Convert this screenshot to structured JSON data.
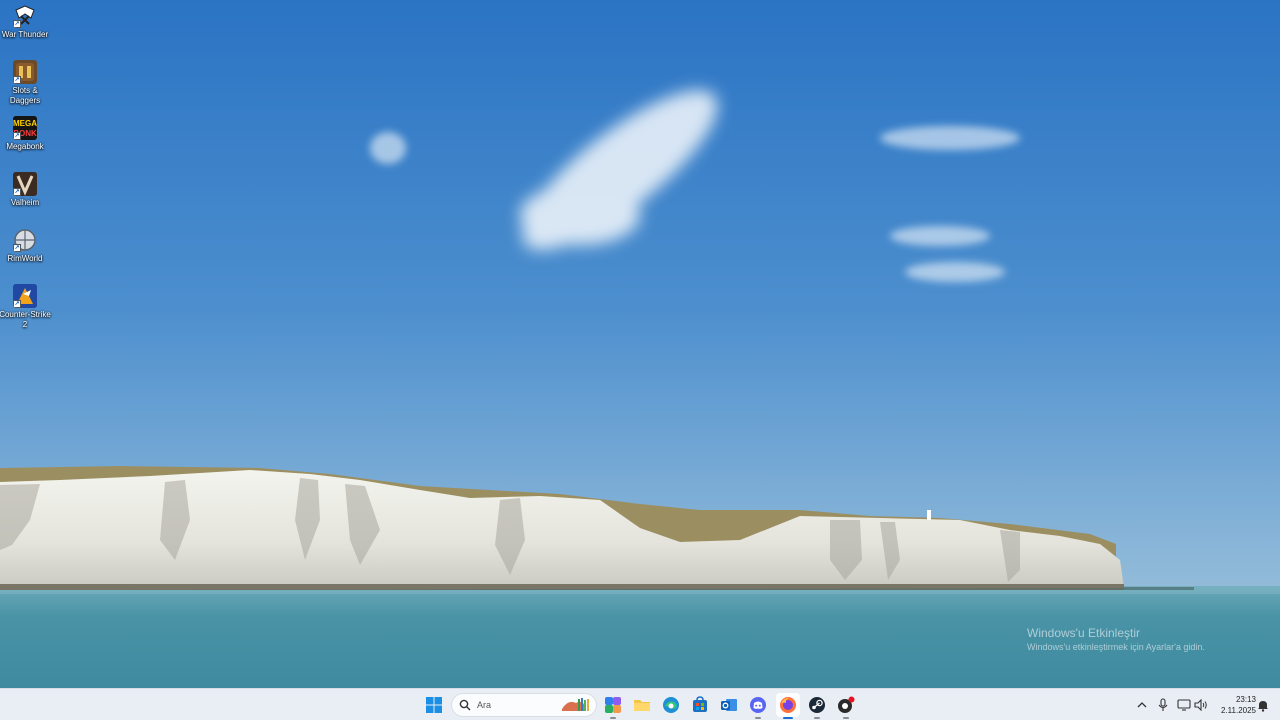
{
  "desktop": {
    "icons": [
      {
        "label": "War Thunder",
        "icon": "war-thunder-icon"
      },
      {
        "label": "Slots & Daggers",
        "icon": "slots-daggers-icon"
      },
      {
        "label": "Megabonk",
        "icon": "megabonk-icon",
        "glyph": "MEGA\nBONK"
      },
      {
        "label": "Valheim",
        "icon": "valheim-icon",
        "glyph": "V"
      },
      {
        "label": "RimWorld",
        "icon": "rimworld-icon"
      },
      {
        "label": "Counter-Strike 2",
        "icon": "counter-strike-2-icon"
      }
    ]
  },
  "activation": {
    "title": "Windows'u Etkinleştir",
    "subtitle": "Windows'u etkinleştirmek için Ayarlar'a gidin."
  },
  "taskbar": {
    "search_placeholder": "Ara",
    "apps": [
      {
        "name": "start-button",
        "icon": "windows-logo-icon"
      },
      {
        "name": "copilot",
        "icon": "copilot-icon"
      },
      {
        "name": "file-explorer",
        "icon": "folder-icon"
      },
      {
        "name": "edge",
        "icon": "edge-icon"
      },
      {
        "name": "microsoft-store",
        "icon": "store-icon"
      },
      {
        "name": "outlook",
        "icon": "outlook-icon"
      },
      {
        "name": "discord",
        "icon": "discord-icon"
      },
      {
        "name": "firefox",
        "icon": "firefox-icon"
      },
      {
        "name": "steam",
        "icon": "steam-icon"
      },
      {
        "name": "app-with-badge",
        "icon": "notification-app-icon"
      }
    ],
    "tray": {
      "time": "23:13",
      "date": "2.11.2025"
    }
  },
  "colors": {
    "sky_top": "#2f78c6",
    "sky_bottom": "#a9c9de",
    "sea": "#4f96a8",
    "taskbar": "#e9eef5",
    "accent": "#1a6fd1"
  }
}
